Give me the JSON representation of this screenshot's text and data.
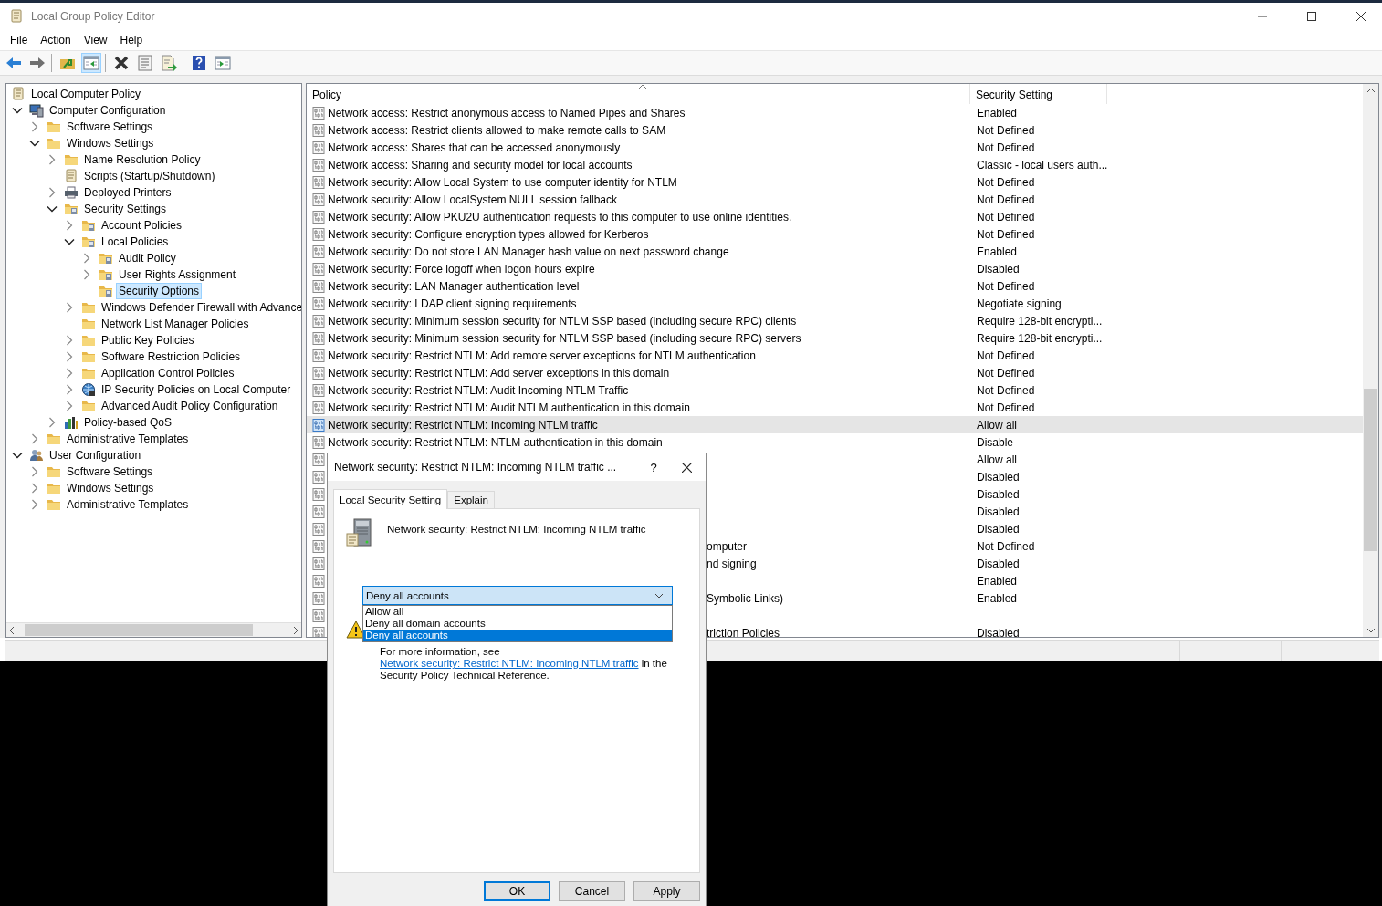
{
  "window": {
    "title": "Local Group Policy Editor"
  },
  "menu": [
    "File",
    "Action",
    "View",
    "Help"
  ],
  "toolbar": [
    [
      {
        "kind": "back",
        "pressed": false
      },
      {
        "kind": "forward",
        "pressed": false
      }
    ],
    [
      {
        "kind": "up",
        "pressed": false
      },
      {
        "kind": "tree",
        "pressed": true
      }
    ],
    [
      {
        "kind": "delete",
        "pressed": false
      },
      {
        "kind": "properties",
        "pressed": false
      },
      {
        "kind": "export",
        "pressed": false
      }
    ],
    [
      {
        "kind": "help",
        "pressed": false
      },
      {
        "kind": "view",
        "pressed": false
      }
    ]
  ],
  "tree": [
    {
      "label": "Local Computer Policy",
      "kind": "policy",
      "selected": false,
      "children": [
        {
          "label": "Computer Configuration",
          "kind": "computer",
          "expanded": true,
          "selected": false,
          "children": [
            {
              "label": "Software Settings",
              "kind": "folder",
              "expanded": false,
              "selected": false
            },
            {
              "label": "Windows Settings",
              "kind": "folder",
              "expanded": true,
              "selected": false,
              "children": [
                {
                  "label": "Name Resolution Policy",
                  "kind": "folder",
                  "expanded": false,
                  "selected": false
                },
                {
                  "label": "Scripts (Startup/Shutdown)",
                  "kind": "script",
                  "selected": false
                },
                {
                  "label": "Deployed Printers",
                  "kind": "printer",
                  "expanded": false,
                  "selected": false
                },
                {
                  "label": "Security Settings",
                  "kind": "secfolder",
                  "expanded": true,
                  "selected": false,
                  "children": [
                    {
                      "label": "Account Policies",
                      "kind": "secfolder",
                      "expanded": false,
                      "selected": false
                    },
                    {
                      "label": "Local Policies",
                      "kind": "secfolder",
                      "expanded": true,
                      "selected": false,
                      "children": [
                        {
                          "label": "Audit Policy",
                          "kind": "secfolder",
                          "expanded": false,
                          "selected": false
                        },
                        {
                          "label": "User Rights Assignment",
                          "kind": "secfolder",
                          "expanded": false,
                          "selected": false
                        },
                        {
                          "label": "Security Options",
                          "kind": "secfolder",
                          "selected": true
                        }
                      ]
                    },
                    {
                      "label": "Windows Defender Firewall with Advance",
                      "kind": "folder",
                      "expanded": false,
                      "selected": false
                    },
                    {
                      "label": "Network List Manager Policies",
                      "kind": "folder",
                      "selected": false
                    },
                    {
                      "label": "Public Key Policies",
                      "kind": "folder",
                      "expanded": false,
                      "selected": false
                    },
                    {
                      "label": "Software Restriction Policies",
                      "kind": "folder",
                      "expanded": false,
                      "selected": false
                    },
                    {
                      "label": "Application Control Policies",
                      "kind": "folder",
                      "expanded": false,
                      "selected": false
                    },
                    {
                      "label": "IP Security Policies on Local Computer",
                      "kind": "ipsec",
                      "expanded": false,
                      "selected": false
                    },
                    {
                      "label": "Advanced Audit Policy Configuration",
                      "kind": "folder",
                      "expanded": false,
                      "selected": false
                    }
                  ]
                },
                {
                  "label": "Policy-based QoS",
                  "kind": "chart",
                  "expanded": false,
                  "selected": false
                }
              ]
            },
            {
              "label": "Administrative Templates",
              "kind": "folder",
              "expanded": false,
              "selected": false
            }
          ]
        },
        {
          "label": "User Configuration",
          "kind": "user",
          "expanded": true,
          "selected": false,
          "children": [
            {
              "label": "Software Settings",
              "kind": "folder",
              "expanded": false,
              "selected": false
            },
            {
              "label": "Windows Settings",
              "kind": "folder",
              "expanded": false,
              "selected": false
            },
            {
              "label": "Administrative Templates",
              "kind": "folder",
              "expanded": false,
              "selected": false
            }
          ]
        }
      ]
    }
  ],
  "table": {
    "columns": [
      {
        "label": "Policy",
        "sorted": true
      },
      {
        "label": "Security Setting",
        "sorted": false
      }
    ],
    "rows": [
      {
        "kind": "full",
        "policy": "Network access: Restrict anonymous access to Named Pipes and Shares",
        "setting": "Enabled",
        "selected": false
      },
      {
        "kind": "full",
        "policy": "Network access: Restrict clients allowed to make remote calls to SAM",
        "setting": "Not Defined",
        "selected": false
      },
      {
        "kind": "full",
        "policy": "Network access: Shares that can be accessed anonymously",
        "setting": "Not Defined",
        "selected": false
      },
      {
        "kind": "full",
        "policy": "Network access: Sharing and security model for local accounts",
        "setting": "Classic - local users auth...",
        "selected": false
      },
      {
        "kind": "full",
        "policy": "Network security: Allow Local System to use computer identity for NTLM",
        "setting": "Not Defined",
        "selected": false
      },
      {
        "kind": "full",
        "policy": "Network security: Allow LocalSystem NULL session fallback",
        "setting": "Not Defined",
        "selected": false
      },
      {
        "kind": "full",
        "policy": "Network security: Allow PKU2U authentication requests to this computer to use online identities.",
        "setting": "Not Defined",
        "selected": false
      },
      {
        "kind": "full",
        "policy": "Network security: Configure encryption types allowed for Kerberos",
        "setting": "Not Defined",
        "selected": false
      },
      {
        "kind": "full",
        "policy": "Network security: Do not store LAN Manager hash value on next password change",
        "setting": "Enabled",
        "selected": false
      },
      {
        "kind": "full",
        "policy": "Network security: Force logoff when logon hours expire",
        "setting": "Disabled",
        "selected": false
      },
      {
        "kind": "full",
        "policy": "Network security: LAN Manager authentication level",
        "setting": "Not Defined",
        "selected": false
      },
      {
        "kind": "full",
        "policy": "Network security: LDAP client signing requirements",
        "setting": "Negotiate signing",
        "selected": false
      },
      {
        "kind": "full",
        "policy": "Network security: Minimum session security for NTLM SSP based (including secure RPC) clients",
        "setting": "Require 128-bit encrypti...",
        "selected": false
      },
      {
        "kind": "full",
        "policy": "Network security: Minimum session security for NTLM SSP based (including secure RPC) servers",
        "setting": "Require 128-bit encrypti...",
        "selected": false
      },
      {
        "kind": "full",
        "policy": "Network security: Restrict NTLM: Add remote server exceptions for NTLM authentication",
        "setting": "Not Defined",
        "selected": false
      },
      {
        "kind": "full",
        "policy": "Network security: Restrict NTLM: Add server exceptions in this domain",
        "setting": "Not Defined",
        "selected": false
      },
      {
        "kind": "full",
        "policy": "Network security: Restrict NTLM: Audit Incoming NTLM Traffic",
        "setting": "Not Defined",
        "selected": false
      },
      {
        "kind": "full",
        "policy": "Network security: Restrict NTLM: Audit NTLM authentication in this domain",
        "setting": "Not Defined",
        "selected": false
      },
      {
        "kind": "full",
        "policy": "Network security: Restrict NTLM: Incoming NTLM traffic",
        "setting": "Allow all",
        "selected": true
      },
      {
        "kind": "full",
        "policy": "Network security: Restrict NTLM: NTLM authentication in this domain",
        "setting": "Disable",
        "selected": false
      },
      {
        "kind": "covered",
        "setting": "Allow all",
        "selected": false
      },
      {
        "kind": "covered",
        "setting": "Disabled",
        "selected": false
      },
      {
        "kind": "covered",
        "setting": "Disabled",
        "selected": false
      },
      {
        "kind": "covered",
        "setting": "Disabled",
        "selected": false
      },
      {
        "kind": "covered",
        "setting": "Disabled",
        "selected": false
      },
      {
        "kind": "covered",
        "policy": "omputer",
        "setting": "Not Defined",
        "selected": false
      },
      {
        "kind": "covered",
        "policy": "nd signing",
        "setting": "Disabled",
        "selected": false
      },
      {
        "kind": "covered",
        "setting": "Enabled",
        "selected": false
      },
      {
        "kind": "covered",
        "policy": "Symbolic Links)",
        "setting": "Enabled",
        "selected": false
      },
      {
        "kind": "covered",
        "selected": false
      },
      {
        "kind": "covered",
        "policy": "triction Policies",
        "setting": "Disabled",
        "selected": false
      }
    ]
  },
  "dialog": {
    "title": "Network security: Restrict NTLM: Incoming NTLM traffic ...",
    "help": "?",
    "tabs": [
      {
        "label": "Local Security Setting",
        "selected": true
      },
      {
        "label": "Explain",
        "selected": false
      }
    ],
    "setting_name": "Network security: Restrict NTLM: Incoming NTLM traffic",
    "dropdown": {
      "value": "Deny all accounts",
      "expanded": true,
      "options": [
        {
          "label": "Allow all",
          "selected": false
        },
        {
          "label": "Deny all domain accounts",
          "selected": false
        },
        {
          "label": "Deny all accounts",
          "selected": true
        }
      ]
    },
    "info": {
      "before": "For more information, see ",
      "link": "Network security: Restrict NTLM: Incoming NTLM traffic",
      "after": " in the Security Policy Technical Reference."
    },
    "buttons": [
      {
        "label": "OK",
        "default": true
      },
      {
        "label": "Cancel",
        "default": false
      },
      {
        "label": "Apply",
        "default": false
      }
    ]
  }
}
